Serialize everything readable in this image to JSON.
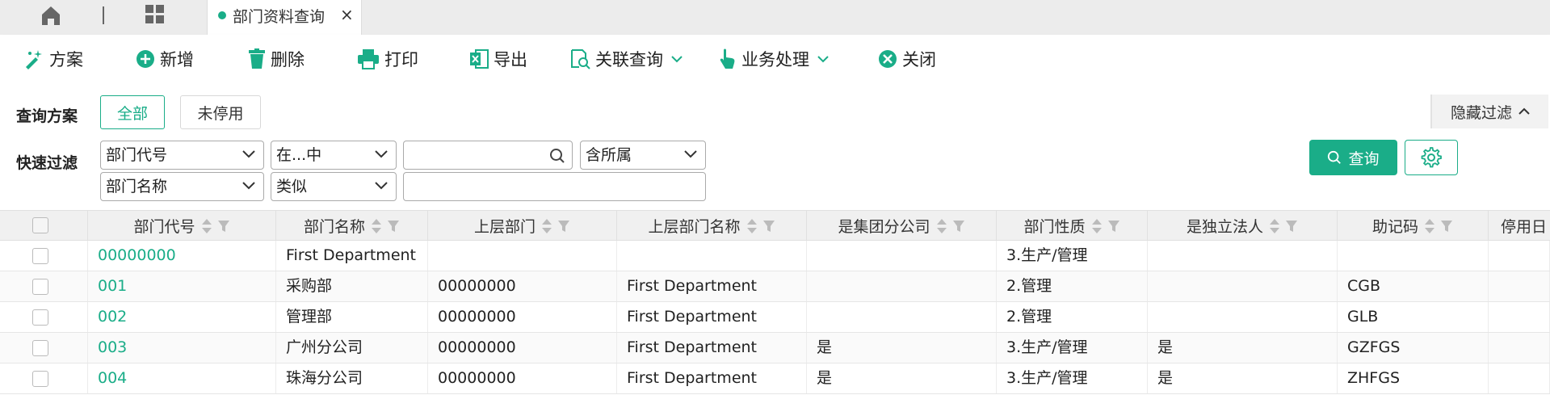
{
  "tabs": {
    "active_label": "部门资料查询",
    "close_glyph": "×"
  },
  "toolbar": {
    "scheme": "方案",
    "add": "新增",
    "delete": "删除",
    "print": "打印",
    "export": "导出",
    "related_query": "关联查询",
    "business": "业务处理",
    "close": "关闭"
  },
  "filter": {
    "scheme_label": "查询方案",
    "scheme_all": "全部",
    "scheme_not_disabled": "未停用",
    "quick_label": "快速过滤",
    "row1": {
      "field": "部门代号",
      "op": "在...中",
      "value": "",
      "scope": "含所属"
    },
    "row2": {
      "field": "部门名称",
      "op": "类似",
      "value": ""
    },
    "hide_filter": "隐藏过滤",
    "query_button": "查询"
  },
  "grid": {
    "columns": [
      "部门代号",
      "部门名称",
      "上层部门",
      "上层部门名称",
      "是集团分公司",
      "部门性质",
      "是独立法人",
      "助记码",
      "停用日"
    ],
    "rows": [
      [
        "00000000",
        "First Department",
        "",
        "",
        "",
        "3.生产/管理",
        "",
        "",
        ""
      ],
      [
        "001",
        "采购部",
        "00000000",
        "First Department",
        "",
        "2.管理",
        "",
        "CGB",
        ""
      ],
      [
        "002",
        "管理部",
        "00000000",
        "First Department",
        "",
        "2.管理",
        "",
        "GLB",
        ""
      ],
      [
        "003",
        "广州分公司",
        "00000000",
        "First Department",
        "是",
        "3.生产/管理",
        "是",
        "GZFGS",
        ""
      ],
      [
        "004",
        "珠海分公司",
        "00000000",
        "First Department",
        "是",
        "3.生产/管理",
        "是",
        "ZHFGS",
        ""
      ]
    ]
  },
  "colors": {
    "accent": "#1aad88"
  }
}
